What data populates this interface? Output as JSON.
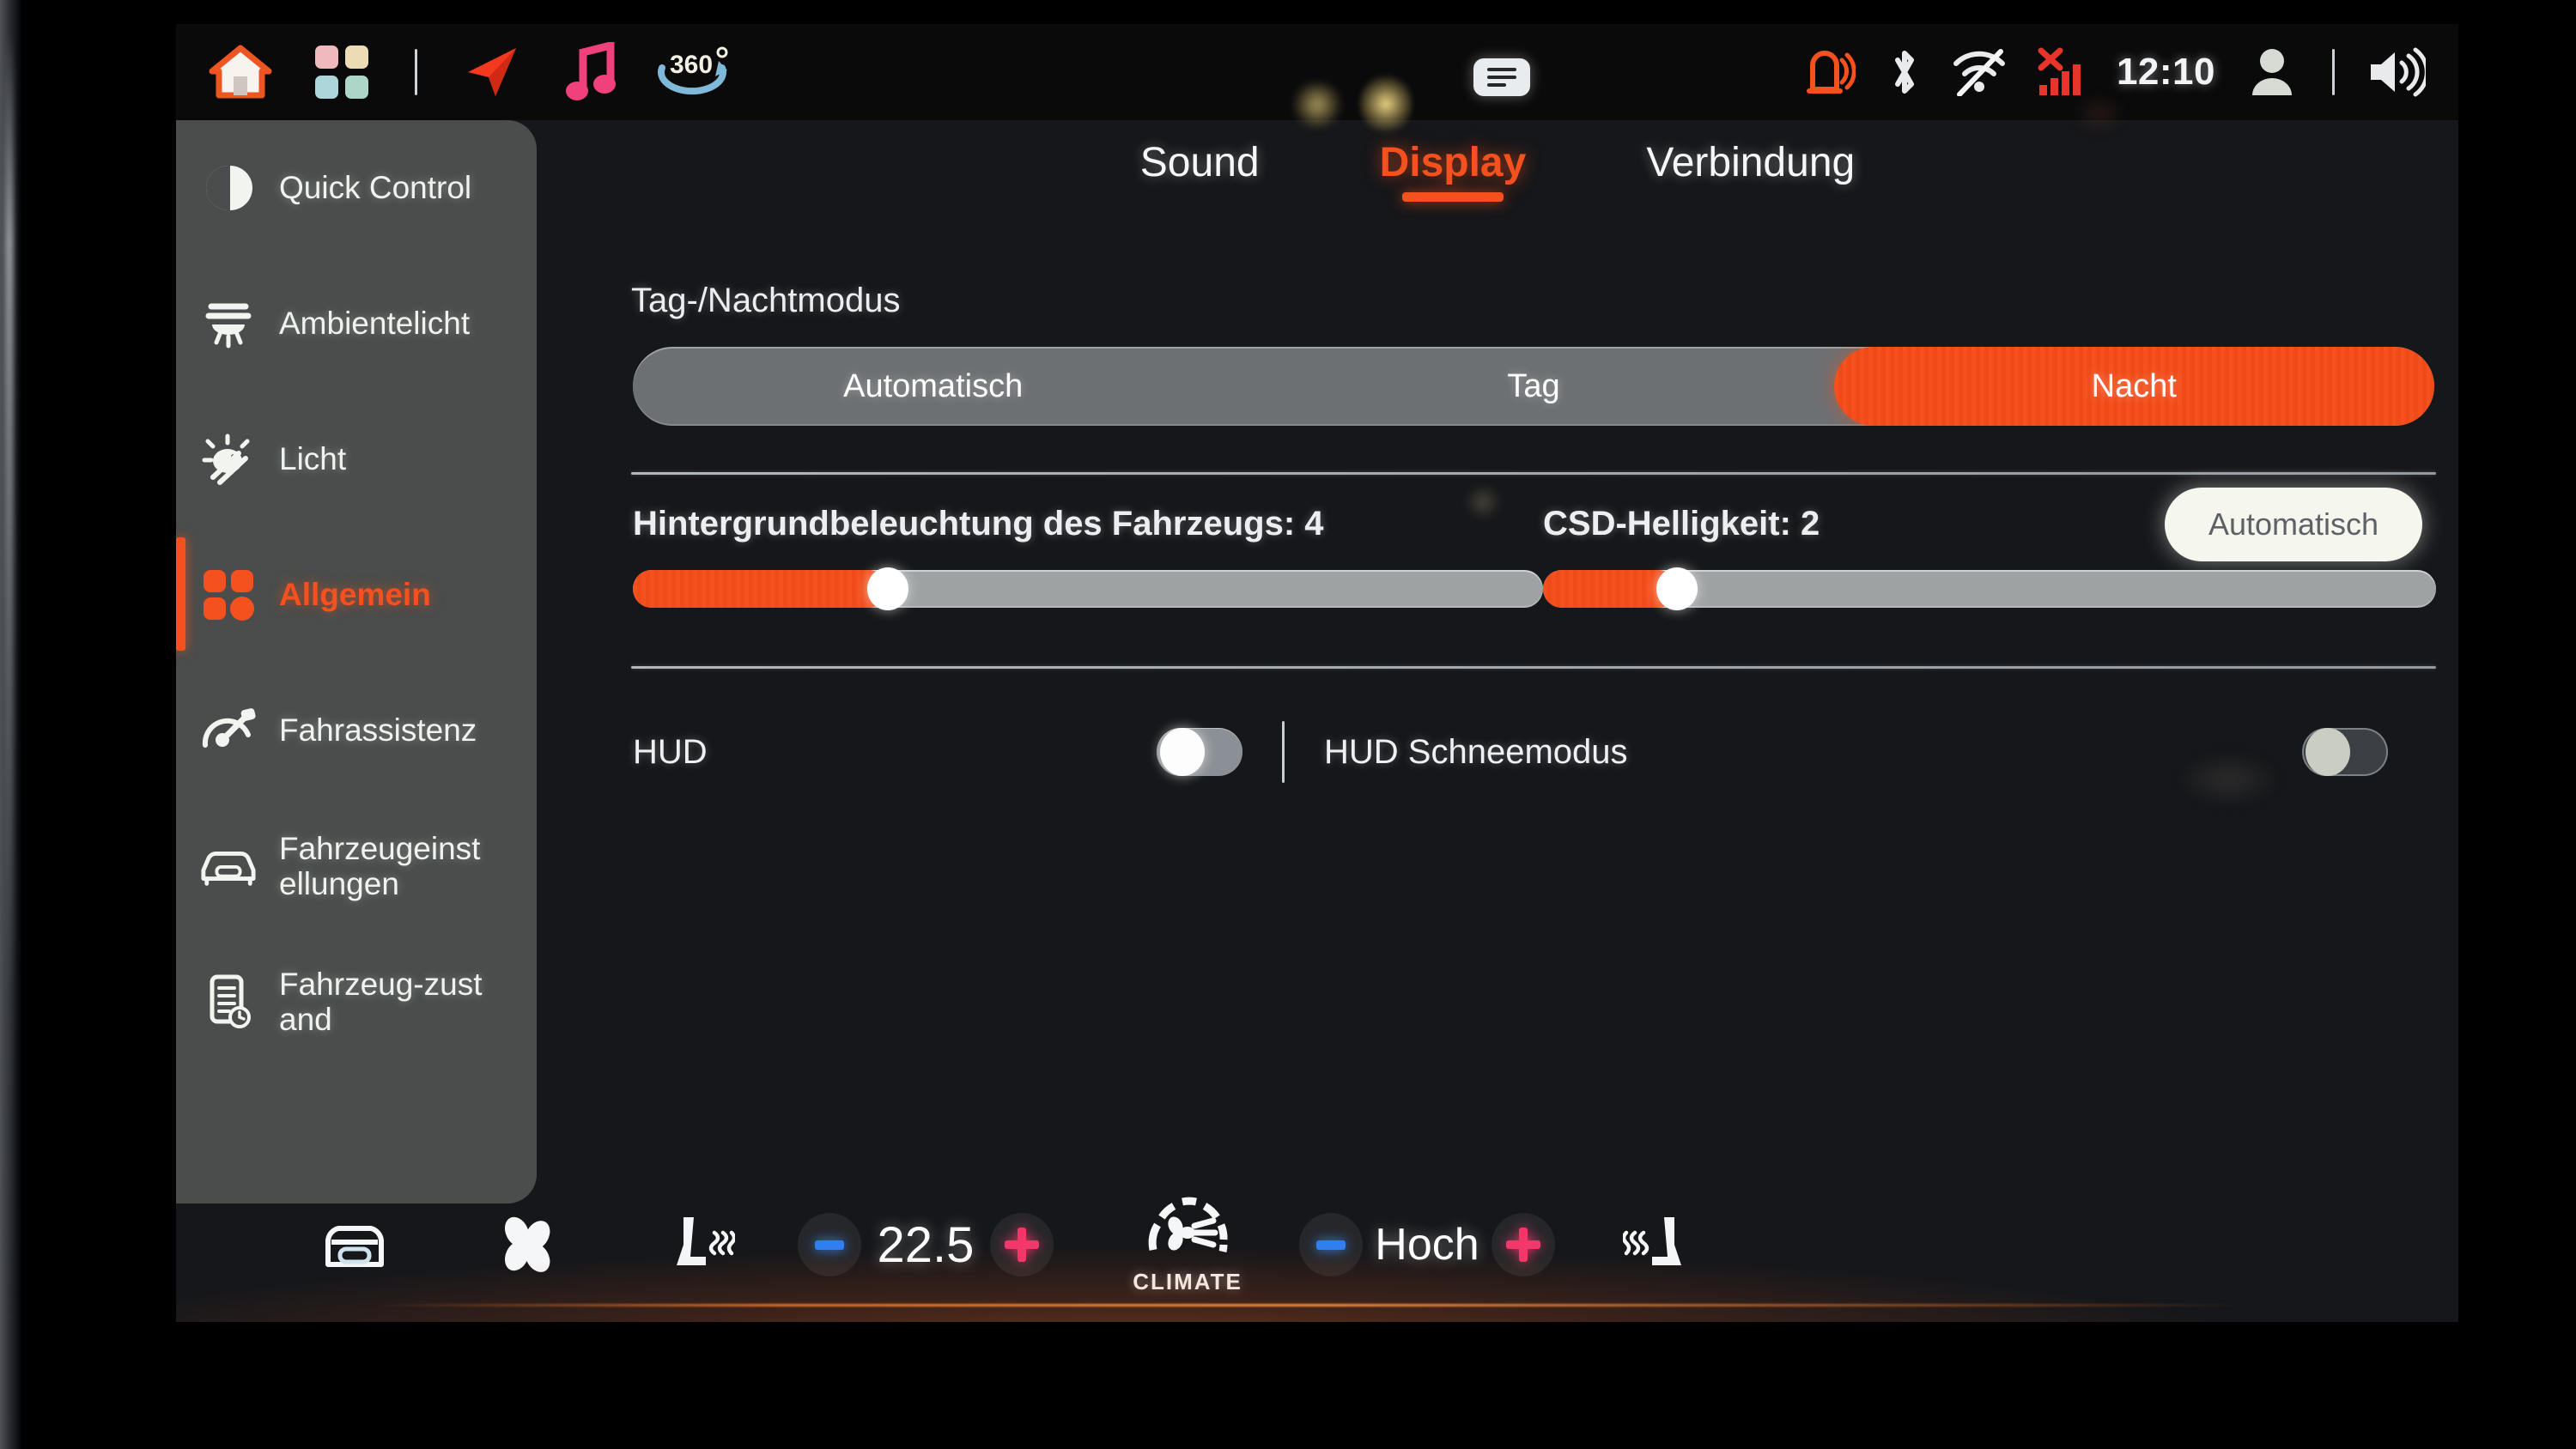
{
  "status_bar": {
    "left_icons": [
      {
        "name": "home-icon",
        "label": "Home"
      },
      {
        "name": "apps-grid-icon",
        "label": "Apps"
      },
      {
        "name": "navigation-arrow-icon",
        "label": "Navigation"
      },
      {
        "name": "music-note-icon",
        "label": "Media"
      },
      {
        "name": "surround-view-360-icon",
        "label": "360"
      }
    ],
    "center_icon": {
      "name": "menu-list-icon",
      "label": "Menu"
    },
    "right_icons": [
      {
        "name": "tire-pressure-warning-icon",
        "label": "Tire pressure warning",
        "color": "#f4511e"
      },
      {
        "name": "bluetooth-icon",
        "label": "Bluetooth",
        "color": "#e8eaec"
      },
      {
        "name": "wifi-off-icon",
        "label": "WiFi off",
        "color": "#e8eaec"
      },
      {
        "name": "cellular-signal-error-icon",
        "label": "Cellular no service",
        "color": "#e8342a"
      },
      {
        "name": "user-profile-icon",
        "label": "Profile",
        "color": "#d8dbd4"
      },
      {
        "name": "volume-icon",
        "label": "Volume",
        "color": "#e8eaec"
      }
    ],
    "clock": "12:10"
  },
  "sidebar": {
    "items": [
      {
        "label": "Quick Control",
        "icon": "quick-control-icon",
        "active": false
      },
      {
        "label": "Ambientelicht",
        "icon": "ambient-light-icon",
        "active": false
      },
      {
        "label": "Licht",
        "icon": "light-icon",
        "active": false
      },
      {
        "label": "Allgemein",
        "icon": "general-grid-icon",
        "active": true
      },
      {
        "label": "Fahrassistenz",
        "icon": "driver-assistance-icon",
        "active": false
      },
      {
        "label": "Fahrzeugeinstellungen",
        "icon": "vehicle-settings-icon",
        "active": false
      },
      {
        "label": "Fahrzeug-zustand",
        "icon": "vehicle-status-icon",
        "active": false
      }
    ]
  },
  "tabs": [
    {
      "label": "Sound",
      "active": false
    },
    {
      "label": "Display",
      "active": true
    },
    {
      "label": "Verbindung",
      "active": false
    }
  ],
  "display_settings": {
    "day_night": {
      "label": "Tag-/Nachtmodus",
      "options": [
        "Automatisch",
        "Tag",
        "Nacht"
      ],
      "selected": "Nacht"
    },
    "vehicle_backlight": {
      "label": "Hintergrundbeleuchtung des Fahrzeugs: 4",
      "value": 4,
      "percent": 28
    },
    "csd_brightness": {
      "label": "CSD-Helligkeit: 2",
      "value": 2,
      "percent": 15
    },
    "auto_button": {
      "label": "Automatisch"
    },
    "hud": {
      "label": "HUD",
      "on": false
    },
    "hud_snow_mode": {
      "label": "HUD Schneemodus",
      "on": false,
      "disabled": true
    }
  },
  "climate": {
    "defrost_icon": "front-defrost-icon",
    "fan_icon": "fan-icon",
    "seat_heat_left_icon": "heated-seat-left-icon",
    "temperature": "22.5",
    "temp_minus": "−",
    "temp_plus": "+",
    "climate_button_label": "CLIMATE",
    "fan_speed": "Hoch",
    "fan_minus": "−",
    "fan_plus": "+",
    "seat_heat_right_icon": "heated-seat-right-icon"
  },
  "colors": {
    "accent": "#f4511e",
    "screen_bg": "#16171a",
    "sidebar_bg": "#4a4d4c",
    "track": "#9ea2a3",
    "minus_blue": "#2f7ff0",
    "plus_pink": "#f2376a"
  }
}
